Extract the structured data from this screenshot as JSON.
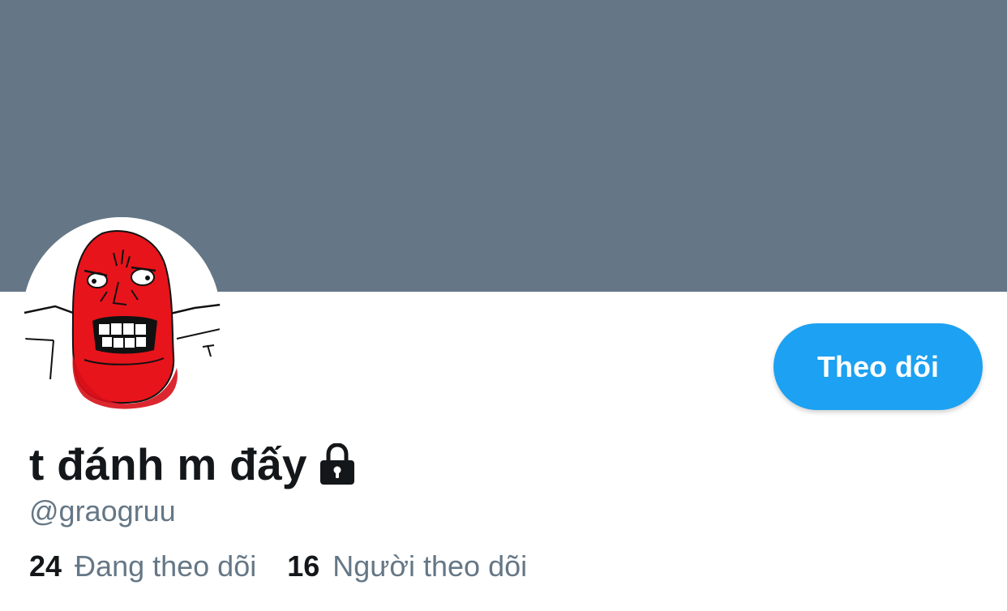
{
  "profile": {
    "display_name": "t đánh m đấy",
    "handle": "@graogruu",
    "locked_icon": "lock-icon",
    "avatar_icon": "rage-face-avatar"
  },
  "actions": {
    "follow_label": "Theo dõi"
  },
  "stats": {
    "following_count": "24",
    "following_label": "Đang theo dõi",
    "followers_count": "16",
    "followers_label": "Người theo dõi"
  },
  "colors": {
    "banner": "#657786",
    "accent": "#1da1f2",
    "text_primary": "#14171a",
    "text_secondary": "#657786"
  }
}
